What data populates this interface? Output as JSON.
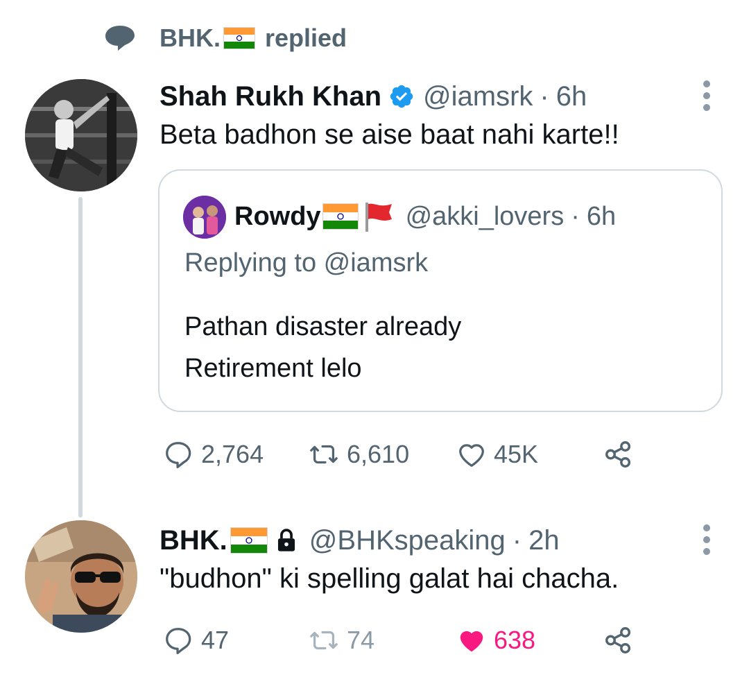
{
  "social_context": {
    "name": "BHK.",
    "action": "replied",
    "icon": "comment-bubble-icon"
  },
  "tweet": {
    "author_name": "Shah Rukh Khan",
    "verified": true,
    "handle": "@iamsrk",
    "separator": "·",
    "time": "6h",
    "text": "Beta badhon se aise baat nahi karte!!",
    "quoted": {
      "author_name": "Rowdy",
      "handle": "@akki_lovers",
      "separator": "·",
      "time": "6h",
      "replying_to": "Replying to @iamsrk",
      "text_line1": "Pathan disaster already",
      "text_line2": "Retirement lelo"
    },
    "stats": {
      "replies": "2,764",
      "retweets": "6,610",
      "likes": "45K"
    }
  },
  "reply": {
    "author_name": "BHK.",
    "protected": true,
    "handle": "@BHKspeaking",
    "separator": "·",
    "time": "2h",
    "text": "\"budhon\" ki spelling galat hai chacha.",
    "stats": {
      "replies": "47",
      "retweets": "74",
      "likes": "638",
      "liked": true
    }
  },
  "colors": {
    "text": "#0f1419",
    "muted": "#536471",
    "verified": "#1d9bf0",
    "like_active": "#f91880",
    "border": "#cfd9de"
  }
}
